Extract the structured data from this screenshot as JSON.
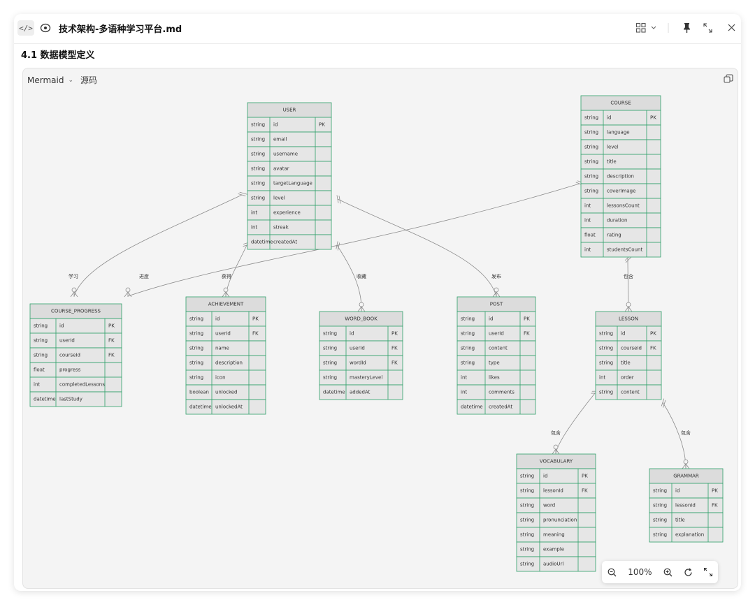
{
  "topbar": {
    "file_name": "技术架构-多语种学习平台.md",
    "code_icon_glyph": "</>"
  },
  "section_title": "4.1 数据模型定义",
  "panel": {
    "lang_label": "Mermaid",
    "source_tab": "源码"
  },
  "zoom": {
    "level": "100%"
  },
  "diagram": {
    "colors": {
      "header": "#dcdcdc",
      "body": "#e6e6e6",
      "border": "#2fa06a",
      "line": "#8c8c8c"
    },
    "entities": [
      {
        "id": "user",
        "name": "USER",
        "rows": [
          [
            "string",
            "id",
            "PK"
          ],
          [
            "string",
            "email",
            ""
          ],
          [
            "string",
            "username",
            ""
          ],
          [
            "string",
            "avatar",
            ""
          ],
          [
            "string",
            "targetLanguage",
            ""
          ],
          [
            "string",
            "level",
            ""
          ],
          [
            "int",
            "experience",
            ""
          ],
          [
            "int",
            "streak",
            ""
          ],
          [
            "datetime",
            "createdAt",
            ""
          ]
        ]
      },
      {
        "id": "course",
        "name": "COURSE",
        "rows": [
          [
            "string",
            "id",
            "PK"
          ],
          [
            "string",
            "language",
            ""
          ],
          [
            "string",
            "level",
            ""
          ],
          [
            "string",
            "title",
            ""
          ],
          [
            "string",
            "description",
            ""
          ],
          [
            "string",
            "coverImage",
            ""
          ],
          [
            "int",
            "lessonsCount",
            ""
          ],
          [
            "int",
            "duration",
            ""
          ],
          [
            "float",
            "rating",
            ""
          ],
          [
            "int",
            "studentsCount",
            ""
          ]
        ]
      },
      {
        "id": "course_progress",
        "name": "COURSE_PROGRESS",
        "rows": [
          [
            "string",
            "id",
            "PK"
          ],
          [
            "string",
            "userId",
            "FK"
          ],
          [
            "string",
            "courseId",
            "FK"
          ],
          [
            "float",
            "progress",
            ""
          ],
          [
            "int",
            "completedLessons",
            ""
          ],
          [
            "datetime",
            "lastStudy",
            ""
          ]
        ]
      },
      {
        "id": "achievement",
        "name": "ACHIEVEMENT",
        "rows": [
          [
            "string",
            "id",
            "PK"
          ],
          [
            "string",
            "userId",
            "FK"
          ],
          [
            "string",
            "name",
            ""
          ],
          [
            "string",
            "description",
            ""
          ],
          [
            "string",
            "icon",
            ""
          ],
          [
            "boolean",
            "unlocked",
            ""
          ],
          [
            "datetime",
            "unlockedAt",
            ""
          ]
        ]
      },
      {
        "id": "word_book",
        "name": "WORD_BOOK",
        "rows": [
          [
            "string",
            "id",
            "PK"
          ],
          [
            "string",
            "userId",
            "FK"
          ],
          [
            "string",
            "wordId",
            "FK"
          ],
          [
            "string",
            "masteryLevel",
            ""
          ],
          [
            "datetime",
            "addedAt",
            ""
          ]
        ]
      },
      {
        "id": "post",
        "name": "POST",
        "rows": [
          [
            "string",
            "id",
            "PK"
          ],
          [
            "string",
            "userId",
            "FK"
          ],
          [
            "string",
            "content",
            ""
          ],
          [
            "string",
            "type",
            ""
          ],
          [
            "int",
            "likes",
            ""
          ],
          [
            "int",
            "comments",
            ""
          ],
          [
            "datetime",
            "createdAt",
            ""
          ]
        ]
      },
      {
        "id": "lesson",
        "name": "LESSON",
        "rows": [
          [
            "string",
            "id",
            "PK"
          ],
          [
            "string",
            "courseId",
            "FK"
          ],
          [
            "string",
            "title",
            ""
          ],
          [
            "int",
            "order",
            ""
          ],
          [
            "string",
            "content",
            ""
          ]
        ]
      },
      {
        "id": "vocabulary",
        "name": "VOCABULARY",
        "rows": [
          [
            "string",
            "id",
            "PK"
          ],
          [
            "string",
            "lessonId",
            "FK"
          ],
          [
            "string",
            "word",
            ""
          ],
          [
            "string",
            "pronunciation",
            ""
          ],
          [
            "string",
            "meaning",
            ""
          ],
          [
            "string",
            "example",
            ""
          ],
          [
            "string",
            "audioUrl",
            ""
          ]
        ]
      },
      {
        "id": "grammar",
        "name": "GRAMMAR",
        "rows": [
          [
            "string",
            "id",
            "PK"
          ],
          [
            "string",
            "lessonId",
            "FK"
          ],
          [
            "string",
            "title",
            ""
          ],
          [
            "string",
            "explanation",
            ""
          ]
        ]
      }
    ],
    "relations": [
      {
        "from": "user",
        "to": "course_progress",
        "label": "学习"
      },
      {
        "from": "course",
        "to": "course_progress",
        "label": "进度"
      },
      {
        "from": "user",
        "to": "achievement",
        "label": "获得"
      },
      {
        "from": "user",
        "to": "word_book",
        "label": "收藏"
      },
      {
        "from": "user",
        "to": "post",
        "label": "发布"
      },
      {
        "from": "course",
        "to": "lesson",
        "label": "包含"
      },
      {
        "from": "lesson",
        "to": "vocabulary",
        "label": "包含"
      },
      {
        "from": "lesson",
        "to": "grammar",
        "label": "包含"
      }
    ]
  }
}
